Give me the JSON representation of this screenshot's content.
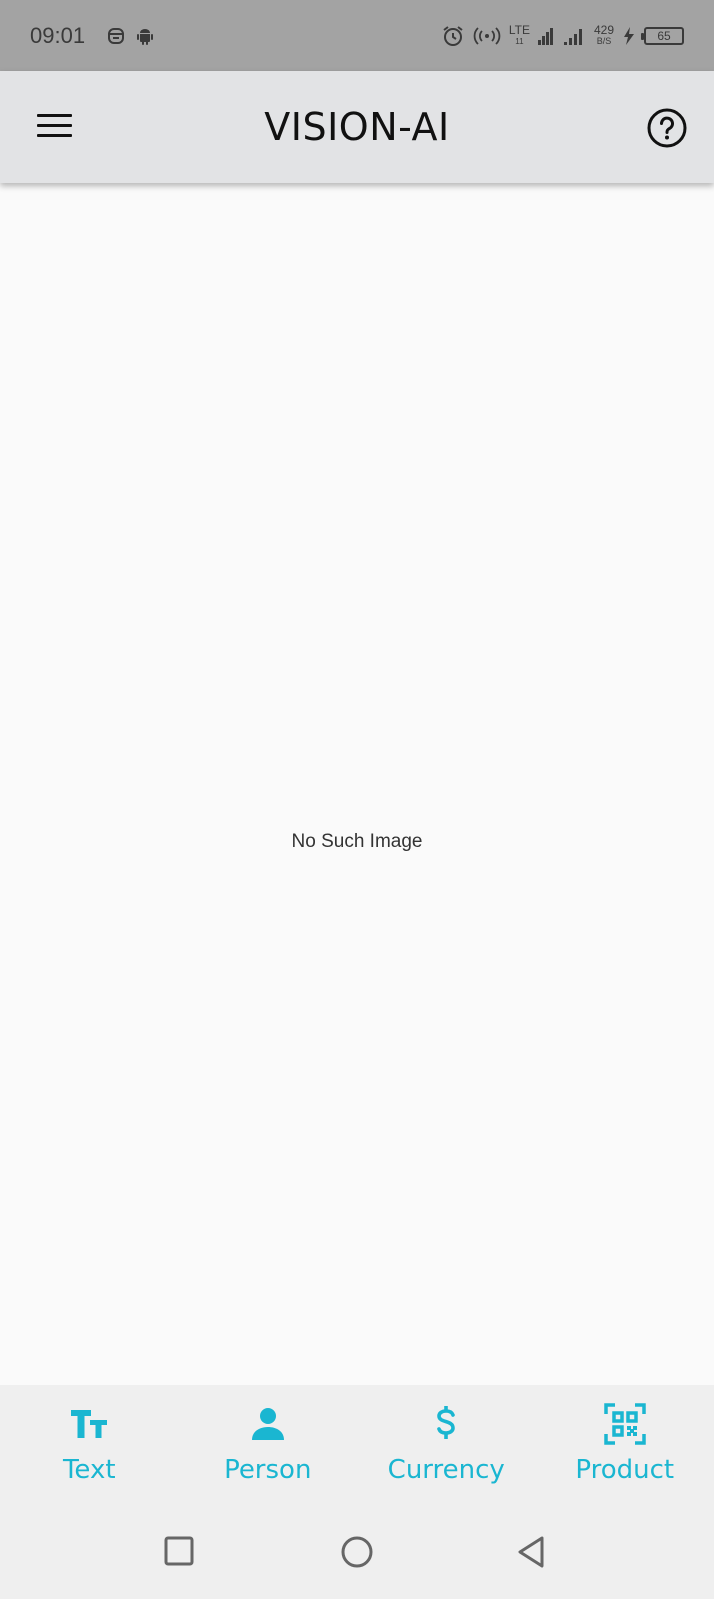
{
  "status_bar": {
    "time": "09:01",
    "network_type": "LTE",
    "net_sub": "11",
    "speed_value": "429",
    "speed_unit": "B/S",
    "battery": "65"
  },
  "app_bar": {
    "title": "VISION-AI",
    "menu_icon": "hamburger-menu-icon",
    "help_icon": "help-circle-icon"
  },
  "main": {
    "message": "No Such Image"
  },
  "bottom_nav": {
    "accent_color": "#1ab6d1",
    "items": [
      {
        "label": "Text",
        "icon": "text-size-icon"
      },
      {
        "label": "Person",
        "icon": "person-icon"
      },
      {
        "label": "Currency",
        "icon": "dollar-icon"
      },
      {
        "label": "Product",
        "icon": "qr-code-scan-icon"
      }
    ]
  },
  "system_nav": {
    "recents_icon": "square-icon",
    "home_icon": "circle-icon",
    "back_icon": "triangle-back-icon"
  }
}
